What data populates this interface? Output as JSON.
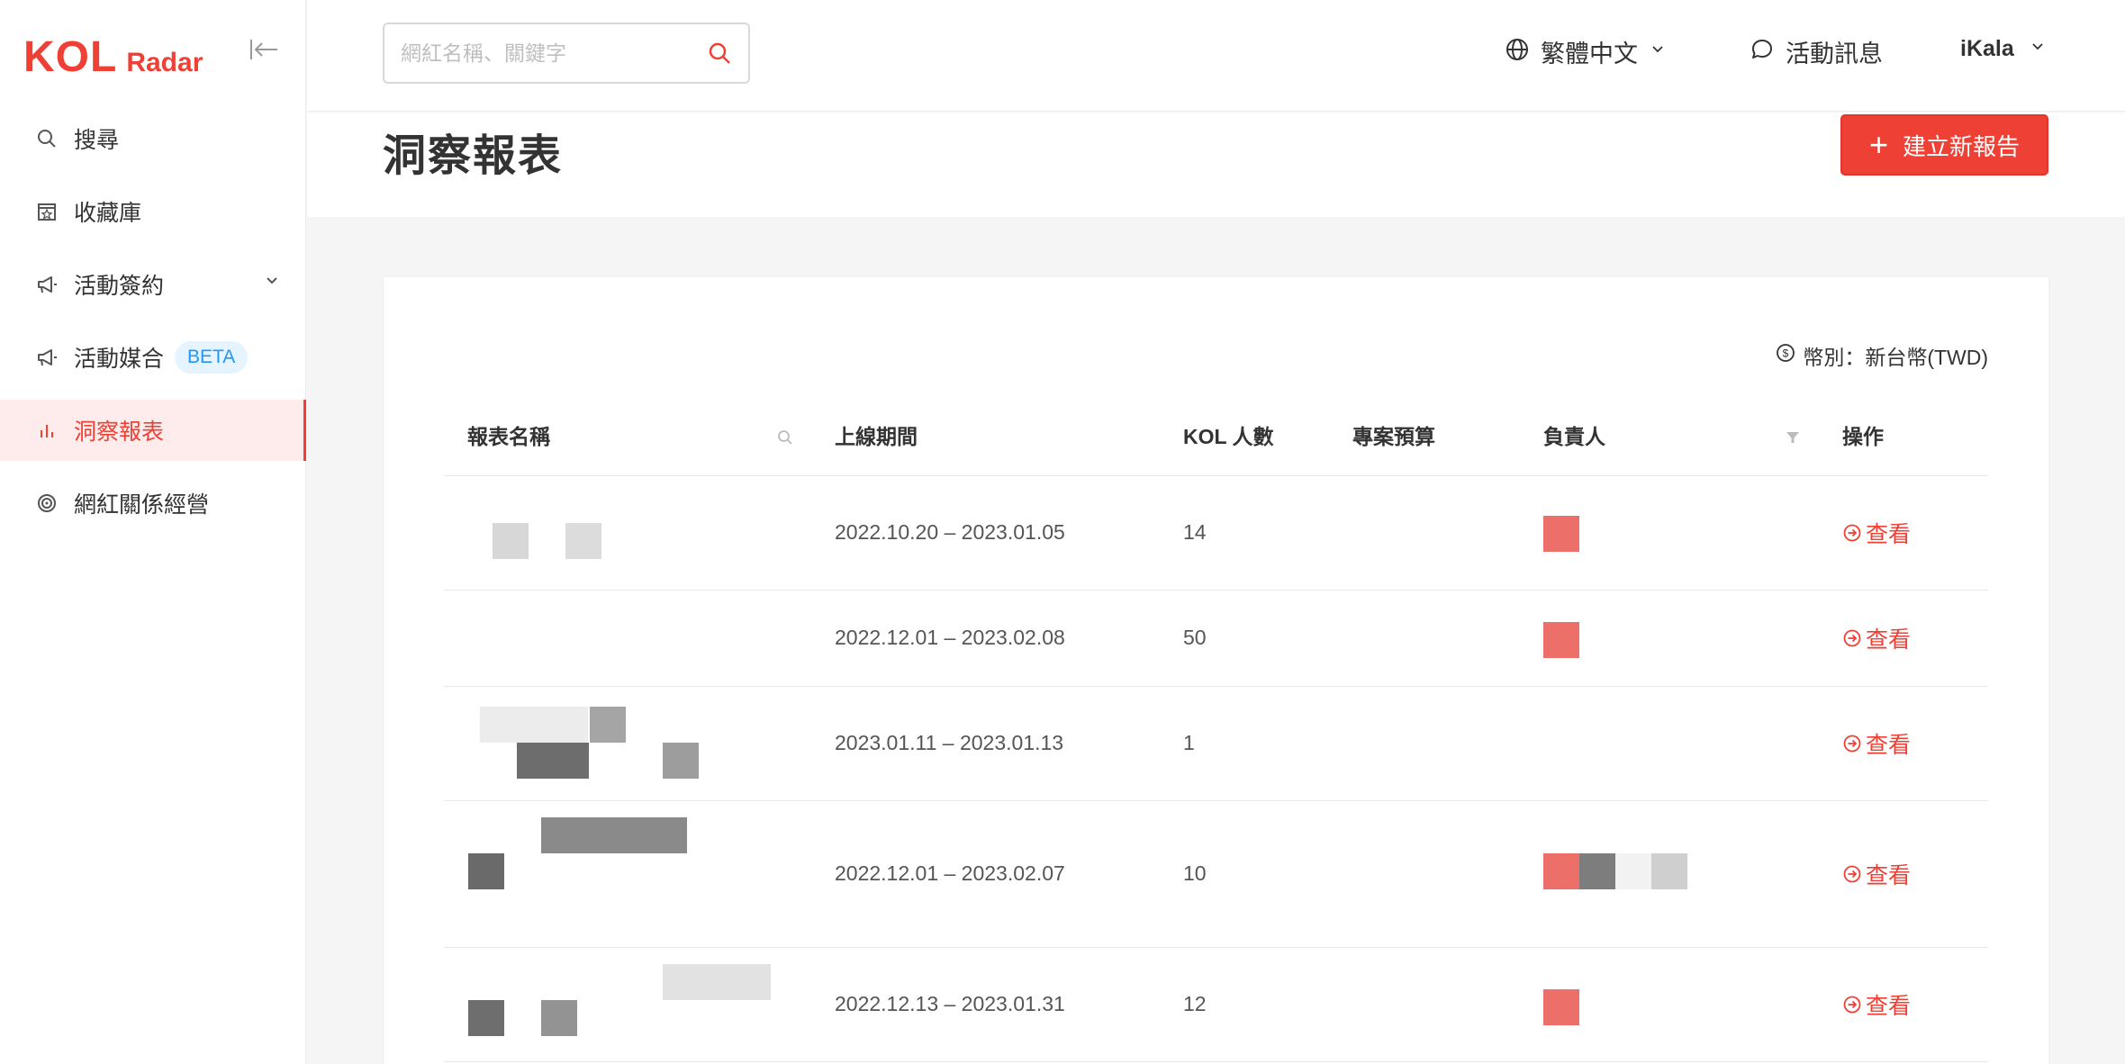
{
  "app": {
    "logo_main": "KOL",
    "logo_sub": "Radar",
    "brand_color": "#ef4036"
  },
  "sidebar": {
    "items": [
      {
        "label": "搜尋",
        "icon": "search-icon"
      },
      {
        "label": "收藏庫",
        "icon": "star-box-icon"
      },
      {
        "label": "活動簽約",
        "icon": "megaphone-icon",
        "expandable": true
      },
      {
        "label": "活動媒合",
        "icon": "megaphone-icon",
        "badge": "BETA"
      },
      {
        "label": "洞察報表",
        "icon": "bar-chart-icon",
        "active": true
      },
      {
        "label": "網紅關係經營",
        "icon": "target-icon"
      }
    ]
  },
  "topbar": {
    "search_placeholder": "網紅名稱、關鍵字",
    "language": "繁體中文",
    "messages": "活動訊息",
    "user": "iKala"
  },
  "page": {
    "title": "洞察報表",
    "create_button": "建立新報告"
  },
  "report_table": {
    "currency_label": "幣別：新台幣(TWD)",
    "columns": [
      "報表名稱",
      "上線期間",
      "KOL 人數",
      "專案預算",
      "負責人",
      "操作"
    ],
    "rows": [
      {
        "period": "2022.10.20 – 2023.01.05",
        "kol_count": "14",
        "action": "查看"
      },
      {
        "period": "2022.12.01 – 2023.02.08",
        "kol_count": "50",
        "action": "查看"
      },
      {
        "period": "2023.01.11 – 2023.01.13",
        "kol_count": "1",
        "action": "查看"
      },
      {
        "period": "2022.12.01 – 2023.02.07",
        "kol_count": "10",
        "action": "查看"
      },
      {
        "period": "2022.12.13 – 2023.01.31",
        "kol_count": "12",
        "action": "查看"
      }
    ]
  }
}
